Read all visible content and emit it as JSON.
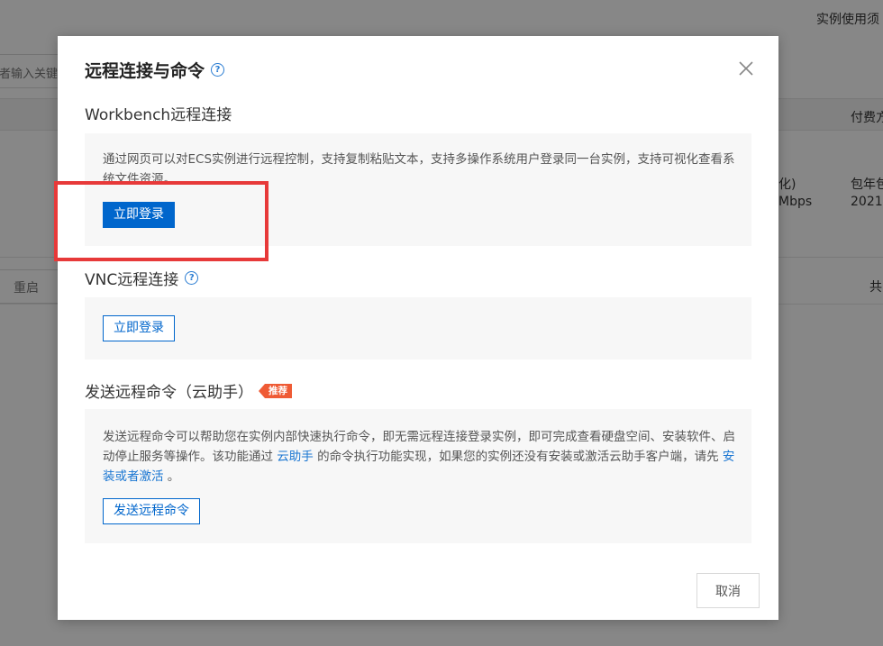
{
  "background": {
    "top_right_link": "实例使用须",
    "search_placeholder": "者输入关键",
    "col_pay": "付费方",
    "row_spec_1": "化)",
    "row_spec_2": "Mbps",
    "row_pay_1": "包年包",
    "row_pay_2": "2021-",
    "restart_label": "重启",
    "right_label": "共"
  },
  "modal": {
    "title": "远程连接与命令",
    "help_glyph": "?",
    "workbench": {
      "title": "Workbench远程连接",
      "description": "通过网页可以对ECS实例进行远程控制，支持复制粘贴文本，支持多操作系统用户登录同一台实例，支持可视化查看系统文件资源。",
      "login_label": "立即登录"
    },
    "vnc": {
      "title": "VNC远程连接",
      "login_label": "立即登录"
    },
    "command": {
      "title": "发送远程命令（云助手）",
      "badge": "推荐",
      "desc_part1": "发送远程命令可以帮助您在实例内部快速执行命令，即无需远程连接登录实例，即可完成查看硬盘空间、安装软件、启动停止服务等操作。该功能通过 ",
      "desc_link1": "云助手",
      "desc_part2": " 的命令执行功能实现，如果您的实例还没有安装或激活云助手客户端，请先 ",
      "desc_link2": "安装或者激活",
      "desc_part3": " 。",
      "send_label": "发送远程命令"
    },
    "cancel_label": "取消"
  },
  "colors": {
    "primary": "#0066cc",
    "link": "#1a76d2",
    "badge": "#ef5b35",
    "highlight": "#e73939"
  }
}
